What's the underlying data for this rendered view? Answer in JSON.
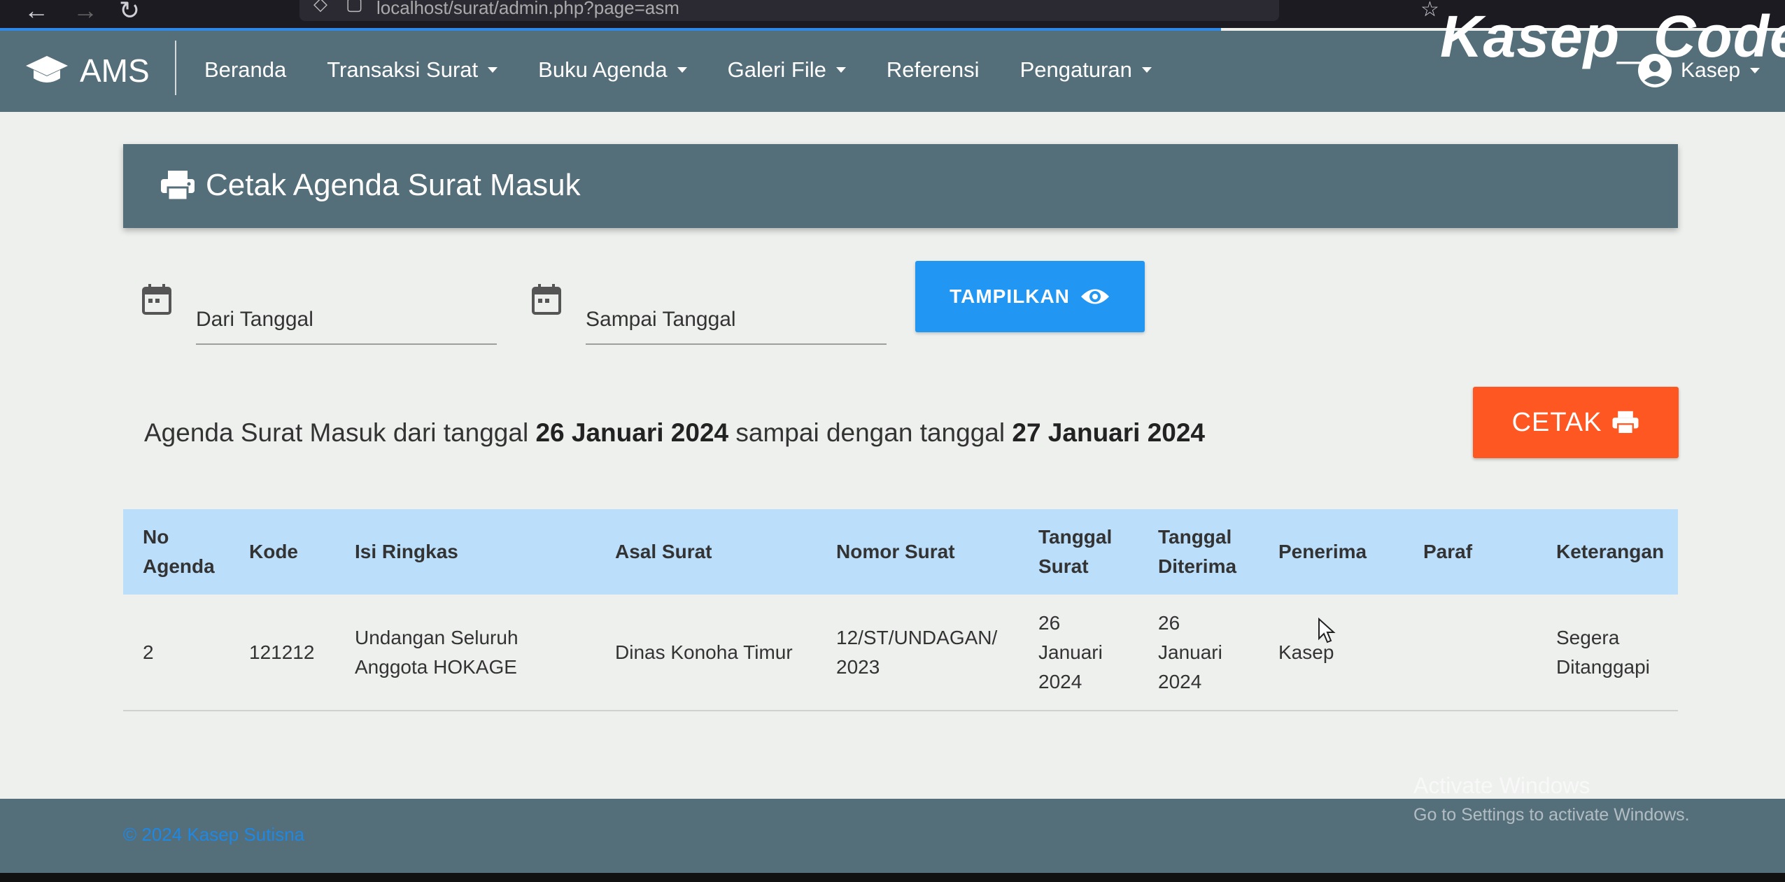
{
  "browser": {
    "url": "localhost/surat/admin.php?page=asm",
    "icons": [
      "back-arrow-icon",
      "forward-arrow-icon",
      "reload-icon",
      "shield-icon",
      "page-icon",
      "star-icon"
    ]
  },
  "watermark": "Kasep_Code",
  "header": {
    "brand": "AMS",
    "brand_icon": "graduation-cap-icon",
    "menu": [
      {
        "label": "Beranda",
        "dropdown": false
      },
      {
        "label": "Transaksi Surat",
        "dropdown": true
      },
      {
        "label": "Buku Agenda",
        "dropdown": true
      },
      {
        "label": "Galeri File",
        "dropdown": true
      },
      {
        "label": "Referensi",
        "dropdown": false
      },
      {
        "label": "Pengaturan",
        "dropdown": true
      }
    ],
    "user": {
      "label": "Kasep",
      "icon": "account-circle-icon"
    }
  },
  "page": {
    "title": "Cetak Agenda Surat Masuk",
    "title_icon": "printer-icon"
  },
  "filter": {
    "from_placeholder": "Dari Tanggal",
    "to_placeholder": "Sampai Tanggal",
    "show_button": "TAMPILKAN",
    "print_button": "CETAK"
  },
  "summary": {
    "prefix": "Agenda Surat Masuk dari tanggal",
    "from": "26 Januari 2024",
    "middle": "sampai dengan tanggal",
    "to": "27 Januari 2024"
  },
  "table": {
    "headers": [
      "No Agenda",
      "Kode",
      "Isi Ringkas",
      "Asal Surat",
      "Nomor Surat",
      "Tanggal Surat",
      "Tanggal Diterima",
      "Penerima",
      "Paraf",
      "Keterangan"
    ],
    "rows": [
      [
        "2",
        "121212",
        "Undangan Seluruh Anggota HOKAGE",
        "Dinas Konoha Timur",
        "12/ST/UNDAGAN/ 2023",
        "26 Januari 2024",
        "26 Januari 2024",
        "Kasep",
        "",
        "Segera Ditanggapi"
      ]
    ]
  },
  "footer": {
    "copyright": "© 2024 Kasep Sutisna"
  },
  "os_overlay": {
    "title": "Activate Windows",
    "subtitle": "Go to Settings to activate Windows."
  },
  "colors": {
    "header_bg": "#546e7a",
    "show_button": "#2196f3",
    "print_button": "#ff5722",
    "table_header": "#bbdefb"
  }
}
